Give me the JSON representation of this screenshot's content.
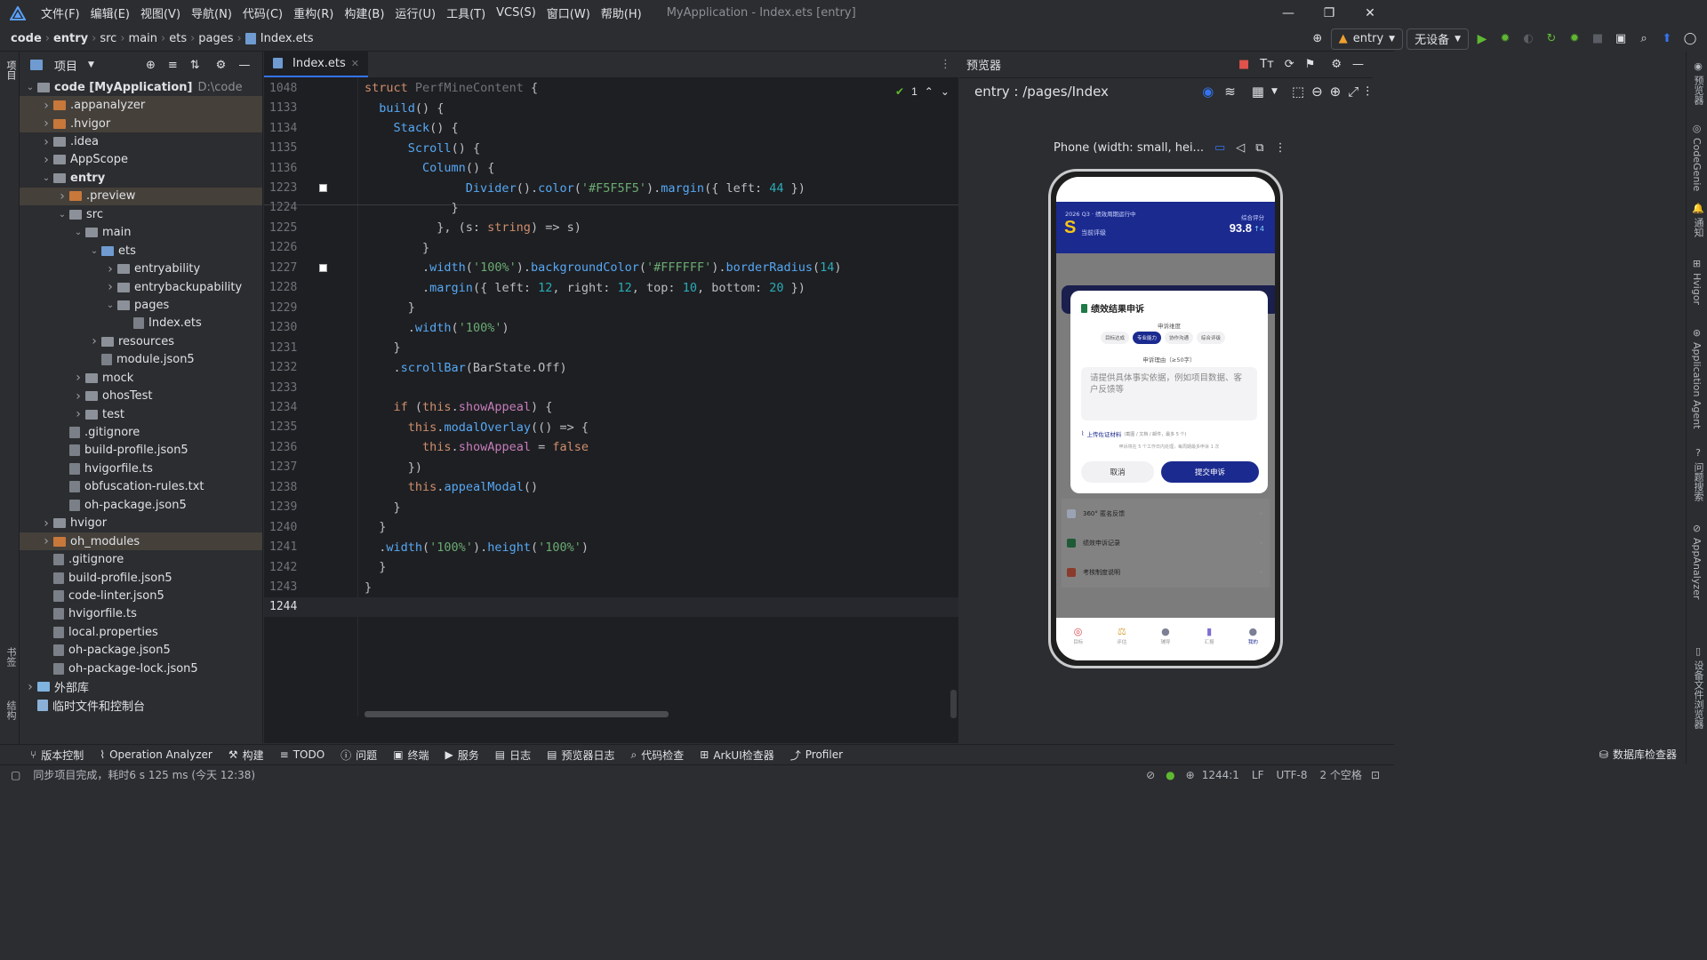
{
  "menu": {
    "items": [
      "文件(F)",
      "编辑(E)",
      "视图(V)",
      "导航(N)",
      "代码(C)",
      "重构(R)",
      "构建(B)",
      "运行(U)",
      "工具(T)",
      "VCS(S)",
      "窗口(W)",
      "帮助(H)"
    ],
    "window_title": "MyApplication - Index.ets [entry]"
  },
  "breadcrumb": [
    "code",
    "entry",
    "src",
    "main",
    "ets",
    "pages",
    "Index.ets"
  ],
  "toolbar": {
    "run_config": "entry",
    "device": "无设备"
  },
  "project": {
    "title": "项目",
    "tree": [
      {
        "arrow": "v",
        "label": "code [MyApplication]",
        "extra": "D:\\code",
        "icon": "folder",
        "hl": false,
        "depth": 0,
        "bold": true
      },
      {
        "arrow": ">",
        "label": ".appanalyzer",
        "icon": "folder-orange",
        "hl": true,
        "depth": 1
      },
      {
        "arrow": ">",
        "label": ".hvigor",
        "icon": "folder-orange",
        "hl": true,
        "depth": 1
      },
      {
        "arrow": ">",
        "label": ".idea",
        "icon": "folder",
        "hl": false,
        "depth": 1
      },
      {
        "arrow": ">",
        "label": "AppScope",
        "icon": "folder",
        "hl": false,
        "depth": 1
      },
      {
        "arrow": "v",
        "label": "entry",
        "icon": "folder",
        "hl": false,
        "depth": 1,
        "bold": true
      },
      {
        "arrow": ">",
        "label": ".preview",
        "icon": "folder-orange",
        "hl": true,
        "depth": 2
      },
      {
        "arrow": "v",
        "label": "src",
        "icon": "folder",
        "hl": false,
        "depth": 2
      },
      {
        "arrow": "v",
        "label": "main",
        "icon": "folder",
        "hl": false,
        "depth": 3
      },
      {
        "arrow": "v",
        "label": "ets",
        "icon": "folder-blue",
        "hl": false,
        "depth": 4
      },
      {
        "arrow": ">",
        "label": "entryability",
        "icon": "folder",
        "hl": false,
        "depth": 5
      },
      {
        "arrow": ">",
        "label": "entrybackupability",
        "icon": "folder",
        "hl": false,
        "depth": 5
      },
      {
        "arrow": "v",
        "label": "pages",
        "icon": "folder",
        "hl": false,
        "depth": 5
      },
      {
        "arrow": "",
        "label": "Index.ets",
        "icon": "file",
        "hl": false,
        "depth": 6
      },
      {
        "arrow": ">",
        "label": "resources",
        "icon": "folder",
        "hl": false,
        "depth": 4
      },
      {
        "arrow": "",
        "label": "module.json5",
        "icon": "file",
        "hl": false,
        "depth": 4
      },
      {
        "arrow": ">",
        "label": "mock",
        "icon": "folder",
        "hl": false,
        "depth": 3
      },
      {
        "arrow": ">",
        "label": "ohosTest",
        "icon": "folder",
        "hl": false,
        "depth": 3
      },
      {
        "arrow": ">",
        "label": "test",
        "icon": "folder",
        "hl": false,
        "depth": 3
      },
      {
        "arrow": "",
        "label": ".gitignore",
        "icon": "file",
        "hl": false,
        "depth": 2
      },
      {
        "arrow": "",
        "label": "build-profile.json5",
        "icon": "file",
        "hl": false,
        "depth": 2
      },
      {
        "arrow": "",
        "label": "hvigorfile.ts",
        "icon": "file",
        "hl": false,
        "depth": 2
      },
      {
        "arrow": "",
        "label": "obfuscation-rules.txt",
        "icon": "file",
        "hl": false,
        "depth": 2
      },
      {
        "arrow": "",
        "label": "oh-package.json5",
        "icon": "file",
        "hl": false,
        "depth": 2
      },
      {
        "arrow": ">",
        "label": "hvigor",
        "icon": "folder",
        "hl": false,
        "depth": 1
      },
      {
        "arrow": ">",
        "label": "oh_modules",
        "icon": "folder-orange",
        "hl": true,
        "depth": 1
      },
      {
        "arrow": "",
        "label": ".gitignore",
        "icon": "file",
        "hl": false,
        "depth": 1
      },
      {
        "arrow": "",
        "label": "build-profile.json5",
        "icon": "file",
        "hl": false,
        "depth": 1
      },
      {
        "arrow": "",
        "label": "code-linter.json5",
        "icon": "file",
        "hl": false,
        "depth": 1
      },
      {
        "arrow": "",
        "label": "hvigorfile.ts",
        "icon": "file",
        "hl": false,
        "depth": 1
      },
      {
        "arrow": "",
        "label": "local.properties",
        "icon": "file",
        "hl": false,
        "depth": 1
      },
      {
        "arrow": "",
        "label": "oh-package.json5",
        "icon": "file",
        "hl": false,
        "depth": 1
      },
      {
        "arrow": "",
        "label": "oh-package-lock.json5",
        "icon": "file",
        "hl": false,
        "depth": 1
      },
      {
        "arrow": ">",
        "label": "外部库",
        "icon": "library",
        "hl": false,
        "depth": 0
      },
      {
        "arrow": "",
        "label": "临时文件和控制台",
        "icon": "scratch",
        "hl": false,
        "depth": 0
      }
    ]
  },
  "editor": {
    "tab": "Index.ets",
    "warnings": "1",
    "lines": [
      {
        "n": "1048",
        "html": "<span class='kw'>struct</span> <span class='ty'>PerfMineContent</span> {"
      },
      {
        "n": "1133",
        "html": "  <span class='fn'>build</span>() {"
      },
      {
        "n": "1134",
        "html": "    <span class='fn'>Stack</span>() {"
      },
      {
        "n": "1135",
        "html": "      <span class='fn'>Scroll</span>() {"
      },
      {
        "n": "1136",
        "html": "        <span class='fn'>Column</span>() {"
      },
      {
        "n": "1223",
        "html": "              <span class='fn'>Divider</span>().<span class='fn'>color</span>(<span class='st'>'#F5F5F5'</span>).<span class='fn'>margin</span>({ left: <span class='nu'>44</span> })",
        "mark": true
      },
      {
        "n": "1224",
        "html": "            }"
      },
      {
        "n": "1225",
        "html": "          }, (s: <span class='kw'>string</span>) => s)"
      },
      {
        "n": "1226",
        "html": "        }"
      },
      {
        "n": "1227",
        "html": "        .<span class='fn'>width</span>(<span class='st'>'100%'</span>).<span class='fn'>backgroundColor</span>(<span class='st'>'#FFFFFF'</span>).<span class='fn'>borderRadius</span>(<span class='nu'>14</span>)",
        "mark": true
      },
      {
        "n": "1228",
        "html": "        .<span class='fn'>margin</span>({ left: <span class='nu'>12</span>, right: <span class='nu'>12</span>, top: <span class='nu'>10</span>, bottom: <span class='nu'>20</span> })"
      },
      {
        "n": "1229",
        "html": "      }"
      },
      {
        "n": "1230",
        "html": "      .<span class='fn'>width</span>(<span class='st'>'100%'</span>)"
      },
      {
        "n": "1231",
        "html": "    }"
      },
      {
        "n": "1232",
        "html": "    .<span class='fn'>scrollBar</span>(BarState.Off)"
      },
      {
        "n": "1233",
        "html": ""
      },
      {
        "n": "1234",
        "html": "    <span class='kw'>if</span> (<span class='kw'>this</span>.<span class='pr'>showAppeal</span>) {"
      },
      {
        "n": "1235",
        "html": "      <span class='kw'>this</span>.<span class='fn'>modalOverlay</span>(() => {"
      },
      {
        "n": "1236",
        "html": "        <span class='kw'>this</span>.<span class='pr'>showAppeal</span> = <span class='kw'>false</span>"
      },
      {
        "n": "1237",
        "html": "      })"
      },
      {
        "n": "1238",
        "html": "      <span class='kw'>this</span>.<span class='fn'>appealModal</span>()"
      },
      {
        "n": "1239",
        "html": "    }"
      },
      {
        "n": "1240",
        "html": "  }"
      },
      {
        "n": "1241",
        "html": "  .<span class='fn'>width</span>(<span class='st'>'100%'</span>).<span class='fn'>height</span>(<span class='st'>'100%'</span>)"
      },
      {
        "n": "1242",
        "html": "  }"
      },
      {
        "n": "1243",
        "html": "}"
      },
      {
        "n": "1244",
        "html": ""
      }
    ]
  },
  "preview": {
    "title": "预览器",
    "path": "entry : /pages/Index",
    "device": "Phone (width: small, hei...",
    "app": {
      "period": "2026 Q3 · 绩效周期运行中",
      "grade": "S",
      "grade_label": "当前评级",
      "score_label": "综合评分",
      "score": "93.8",
      "trend": "↑4",
      "modal_title": "绩效结果申诉",
      "dimension_label": "申诉维度",
      "chips": [
        "目标达成",
        "专业能力",
        "协作沟通",
        "综合评级"
      ],
      "reason_label": "申诉理由（≥50字）",
      "placeholder": "请提供具体事实依据，例如项目数据、客户反馈等",
      "upload": "上传佐证材料",
      "upload_hint": "(截图 / 文档 / 邮件，最多 5 个)",
      "rule_hint": "申诉将在 5 个工作日内处理，每周期最多申诉 1 次",
      "cancel": "取消",
      "submit": "提交申诉",
      "list": [
        "360° 匿名反馈",
        "绩效申诉记录",
        "考核制度说明"
      ],
      "tabs": [
        "目标",
        "评估",
        "辅导",
        "汇报",
        "我的"
      ]
    }
  },
  "left_strip": {
    "project": "项目",
    "bookmarks": "书签",
    "structure": "结构"
  },
  "right_strip": [
    "预览器",
    "CodeGenie",
    "通知",
    "Hvigor",
    "Application Agent",
    "问题搜索",
    "AppAnalyzer",
    "设备文件浏览器"
  ],
  "bottom_tools": [
    "版本控制",
    "Operation Analyzer",
    "构建",
    "TODO",
    "问题",
    "终端",
    "服务",
    "日志",
    "预览器日志",
    "代码检查",
    "ArkUI检查器",
    "Profiler"
  ],
  "db_inspector": "数据库检查器",
  "status": {
    "message": "同步项目完成，耗时6 s 125 ms (今天 12:38)",
    "position": "1244:1",
    "line_sep": "LF",
    "encoding": "UTF-8",
    "indent": "2 个空格"
  },
  "colors": {
    "accent": "#3574f0",
    "app_primary": "#1b2a8f",
    "grade": "#f5c518",
    "run": "#5fb832"
  }
}
